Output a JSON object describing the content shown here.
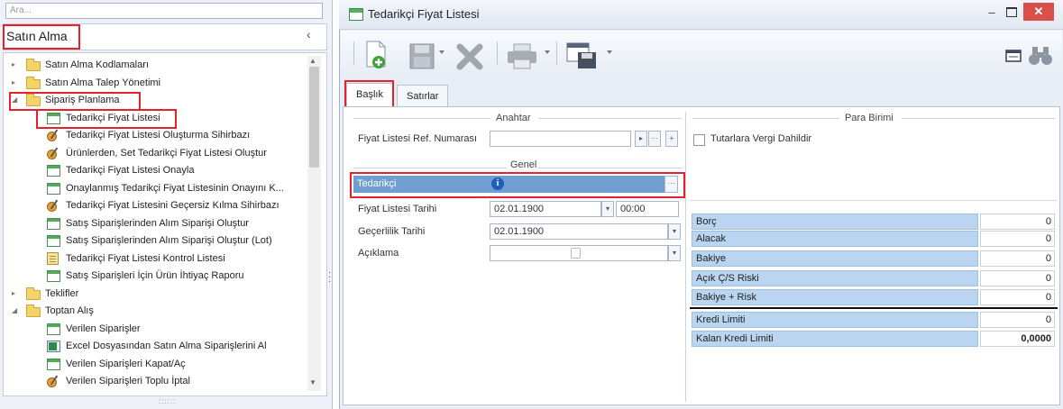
{
  "left_panel": {
    "search_placeholder": "Ara...",
    "module_title": "Satın Alma",
    "collapse_icon": "‹",
    "tree": [
      {
        "label": "Satın Alma Kodlamaları",
        "type": "folder",
        "level": 0,
        "expanded": false
      },
      {
        "label": "Satın Alma Talep Yönetimi",
        "type": "folder",
        "level": 0,
        "expanded": false
      },
      {
        "label": "Sipariş Planlama",
        "type": "folder",
        "level": 0,
        "expanded": true
      },
      {
        "label": "Tedarikçi Fiyat Listesi",
        "type": "form",
        "level": 1
      },
      {
        "label": "Tedarikçi Fiyat Listesi Oluşturma Sihirbazı",
        "type": "wizard",
        "level": 1
      },
      {
        "label": "Ürünlerden, Set Tedarikçi Fiyat Listesi Oluştur",
        "type": "wizard",
        "level": 1
      },
      {
        "label": "Tedarikçi Fiyat Listesi Onayla",
        "type": "form",
        "level": 1
      },
      {
        "label": "Onaylanmış Tedarikçi Fiyat Listesinin Onayını K...",
        "type": "form",
        "level": 1
      },
      {
        "label": "Tedarikçi Fiyat Listesini Geçersiz Kılma Sihirbazı",
        "type": "wizard",
        "level": 1
      },
      {
        "label": "Satış Siparişlerinden Alım Siparişi Oluştur",
        "type": "form",
        "level": 1
      },
      {
        "label": "Satış Siparişlerinden Alım Siparişi Oluştur (Lot)",
        "type": "form",
        "level": 1
      },
      {
        "label": "Tedarikçi Fiyat Listesi Kontrol Listesi",
        "type": "report",
        "level": 1
      },
      {
        "label": "Satış Siparişleri İçin Ürün İhtiyaç Raporu",
        "type": "form",
        "level": 1
      },
      {
        "label": "Teklifler",
        "type": "folder",
        "level": 0,
        "expanded": false
      },
      {
        "label": "Toptan Alış",
        "type": "folder",
        "level": 0,
        "expanded": true
      },
      {
        "label": "Verilen Siparişler",
        "type": "form",
        "level": 1
      },
      {
        "label": "Excel Dosyasından Satın Alma Siparişlerini Al",
        "type": "excel",
        "level": 1
      },
      {
        "label": "Verilen Siparişleri Kapat/Aç",
        "type": "form",
        "level": 1
      },
      {
        "label": "Verilen Siparişleri Toplu İptal",
        "type": "wizard",
        "level": 1
      }
    ],
    "grip": "::::::"
  },
  "window": {
    "title": "Tedarikçi Fiyat Listesi",
    "min_symbol": "–",
    "close_symbol": "✕"
  },
  "toolbar": {
    "icons": [
      "new-document-icon",
      "save-icon",
      "delete-icon",
      "print-icon",
      "layout-save-icon",
      "window-layout-icon",
      "binoculars-icon"
    ]
  },
  "tabs": [
    {
      "label": "Başlık",
      "active": true
    },
    {
      "label": "Satırlar",
      "active": false
    }
  ],
  "form": {
    "anahtar_title": "Anahtar",
    "ref_label": "Fiyat Listesi Ref. Numarası",
    "ref_value": "",
    "genel_title": "Genel",
    "tedarikci_label": "Tedarikçi",
    "tedarikci_value": "",
    "tarih_label": "Fiyat Listesi Tarihi",
    "tarih_value": "02.01.1900",
    "saat_value": "00:00",
    "gecerlilik_label": "Geçerlilik Tarihi",
    "gecerlilik_value": "02.01.1900",
    "aciklama_label": "Açıklama",
    "aciklama_value": ""
  },
  "para_birimi": {
    "title": "Para Birimi",
    "checkbox_label": "Tutarlara Vergi Dahildir",
    "checked": false
  },
  "finance": [
    {
      "label": "Borç",
      "value": "0"
    },
    {
      "label": "Alacak",
      "value": "0"
    },
    {
      "label": "Bakiye",
      "value": "0"
    },
    {
      "label": "Açık Ç/S Riski",
      "value": "0"
    },
    {
      "label": "Bakiye + Risk",
      "value": "0"
    },
    {
      "label": "Kredi Limiti",
      "value": "0"
    },
    {
      "label": "Kalan Kredi Limiti",
      "value": "0,0000"
    }
  ],
  "colors": {
    "highlight_red": "#e8202a",
    "row_blue": "#b9d5ef",
    "selected_field": "#6f9fd0"
  }
}
